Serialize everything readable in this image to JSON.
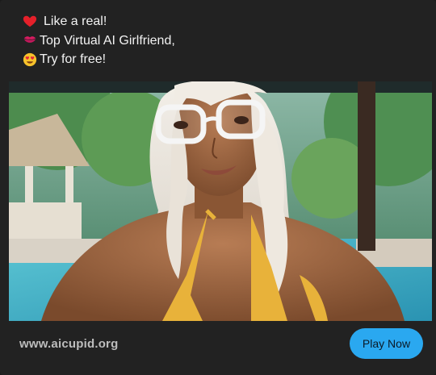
{
  "ad": {
    "lines": [
      {
        "icon": "red-heart-icon",
        "text": "Like a real!"
      },
      {
        "icon": "kiss-lips-icon",
        "text": "Top Virtual AI Girlfriend,"
      },
      {
        "icon": "heart-eyes-icon",
        "text": "Try for free!"
      }
    ],
    "image": {
      "subject": "ai-girlfriend-photo"
    },
    "domain": "www.aicupid.org",
    "cta_label": "Play Now"
  },
  "colors": {
    "background": "#222222",
    "cta": "#2aa8f0",
    "text": "#f2f2f2",
    "domain_text": "#bdbdbd"
  }
}
